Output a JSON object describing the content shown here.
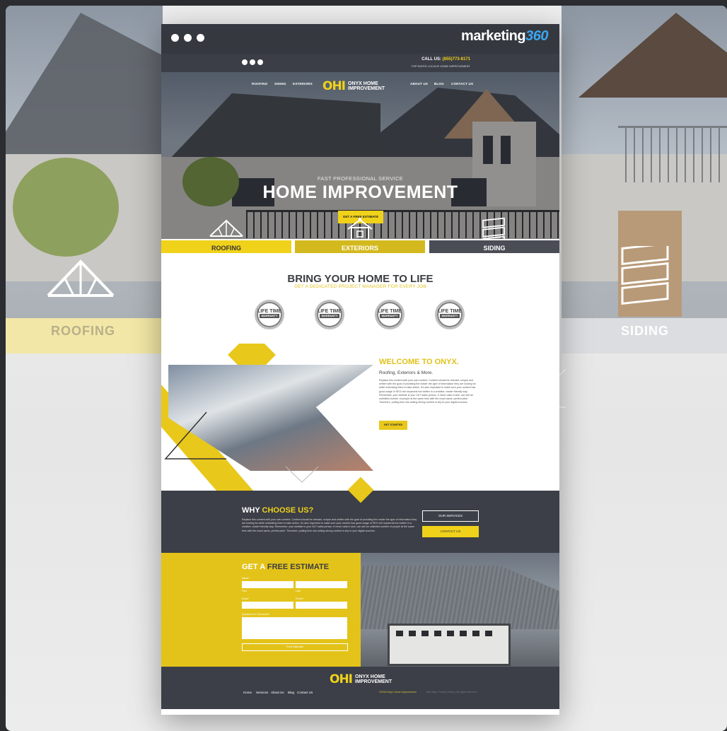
{
  "browser": {
    "brand_text": "marketing",
    "brand_number": "360"
  },
  "topbar": {
    "call_label": "CALL US:",
    "phone": "(855)773-8171",
    "tagline": "TOP RATED LOCAL® HOME IMPROVEMENT"
  },
  "nav": {
    "items": [
      "ROOFING",
      "SIDING",
      "EXTERIORS",
      "ABOUT US",
      "BLOG",
      "CONTACT US"
    ],
    "logo_mark": "OHI",
    "logo_line1": "ONYX HOME",
    "logo_line2": "IMPROVEMENT"
  },
  "hero": {
    "kicker": "FAST PROFESSIONAL SERVICE",
    "title": "HOME IMPROVEMENT",
    "cta": "GET A FREE ESTIMATE"
  },
  "services": {
    "items": [
      {
        "label": "ROOFING",
        "icon": "roof-truss-icon",
        "color": "#f0d21a"
      },
      {
        "label": "EXTERIORS",
        "icon": "house-icon",
        "color": "#d4b91e"
      },
      {
        "label": "SIDING",
        "icon": "siding-panels-icon",
        "color": "#4a4d55"
      }
    ]
  },
  "background": {
    "left_label": "ROOFING",
    "right_label": "SIDING"
  },
  "bring": {
    "title": "BRING YOUR HOME TO LIFE",
    "subtitle": "GET A DEDICATED PROJECT MANAGER FOR EVERY JOB",
    "seal_top": "LIFE TIME",
    "seal_band": "WARRANTY"
  },
  "welcome": {
    "heading": "WELCOME TO ONYX.",
    "sub": "Roofing, Exteriors & More.",
    "body": "Replace this content with your own content. Content should be relevant, unique and written with the goal of providing the reader the type of information they are looking for while motivating them to take action. It's also important to make sure your content has good usage of SEO rich keywords but written in a creative, reader friendly way. Remember, your website is your 24/7 sales person. It never calls in sick, can sell an unlimited number of people at the same time with the exact same, perfect pitch. Therefore, putting time into writing strong content is key to your digital success.",
    "cta": "GET STARTED"
  },
  "why": {
    "title_a": "WHY ",
    "title_b": "CHOOSE US?",
    "body": "Replace this content with your own content. Content should be relevant, unique and written with the goal of providing the reader the type of information they are looking for while motivating them to take action. It's also important to make sure your content has good usage of SEO rich keywords but written in a creative, reader friendly way. Remember, your website is your 24/7 sales person. It never calls in sick, can sell an unlimited number of people at the same time with the exact same, perfect pitch. Therefore, putting time into writing strong content is key to your digital success.",
    "btn_services": "OUR SERVICES",
    "btn_contact": "CONTACT US"
  },
  "estimate": {
    "title_a": "GET A ",
    "title_b": "FREE ESTIMATE",
    "name_label": "Name*",
    "first_label": "First",
    "last_label": "Last",
    "email_label": "Email*",
    "phone_label": "Phone*",
    "comments_label": "Questions or Comments*",
    "submit": "Free Estimate"
  },
  "footer": {
    "links": [
      "Home",
      "Services",
      "About Us",
      "Blog",
      "Contact Us"
    ],
    "copyright": "©2018 Onyx Home Improvement",
    "rights": "Site Map | Privacy Policy | All rights reserved"
  },
  "colors": {
    "accent": "#f0d21a",
    "dark": "#3c3f47",
    "brand_blue": "#3ba6f0"
  }
}
